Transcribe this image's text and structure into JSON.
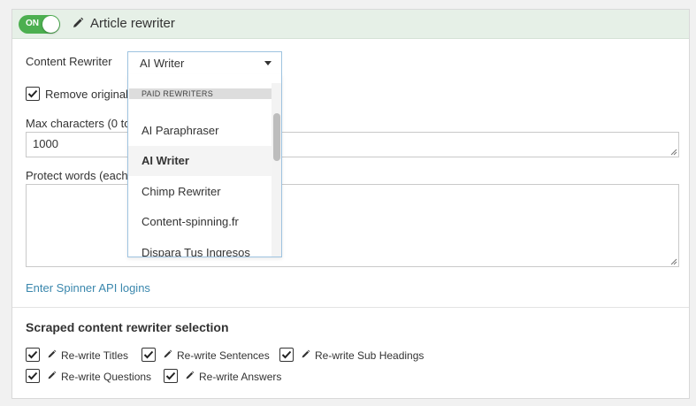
{
  "header": {
    "toggle_label": "ON",
    "title": "Article rewriter"
  },
  "form": {
    "content_rewriter_label": "Content Rewriter",
    "content_rewriter_value": "AI Writer",
    "remove_original_label": "Remove original",
    "remove_original_checked": true,
    "max_chars_label": "Max characters (0 to c",
    "max_chars_value": "1000",
    "protect_words_label": "Protect words (each w",
    "protect_words_value": "",
    "spinner_link": "Enter Spinner API logins"
  },
  "dropdown": {
    "group_label": "PAID REWRITERS",
    "options": [
      "AI Paraphraser",
      "AI Writer",
      "Chimp Rewriter",
      "Content-spinning.fr",
      "Dispara Tus Ingresos"
    ],
    "selected": "AI Writer"
  },
  "scraped": {
    "title": "Scraped content rewriter selection",
    "options": [
      {
        "label": "Re-write Titles",
        "checked": true
      },
      {
        "label": "Re-write Sentences",
        "checked": true
      },
      {
        "label": "Re-write Sub Headings",
        "checked": true
      },
      {
        "label": "Re-write Questions",
        "checked": true
      },
      {
        "label": "Re-write Answers",
        "checked": true
      }
    ]
  },
  "colors": {
    "toggle_on": "#4caf50",
    "header_bg": "#e6f0e7",
    "link": "#3a87ad",
    "select_border": "#9ec3e0"
  },
  "icons": {
    "header": "pencil-icon",
    "option": "pencil-icon",
    "check": "checkmark-icon"
  }
}
